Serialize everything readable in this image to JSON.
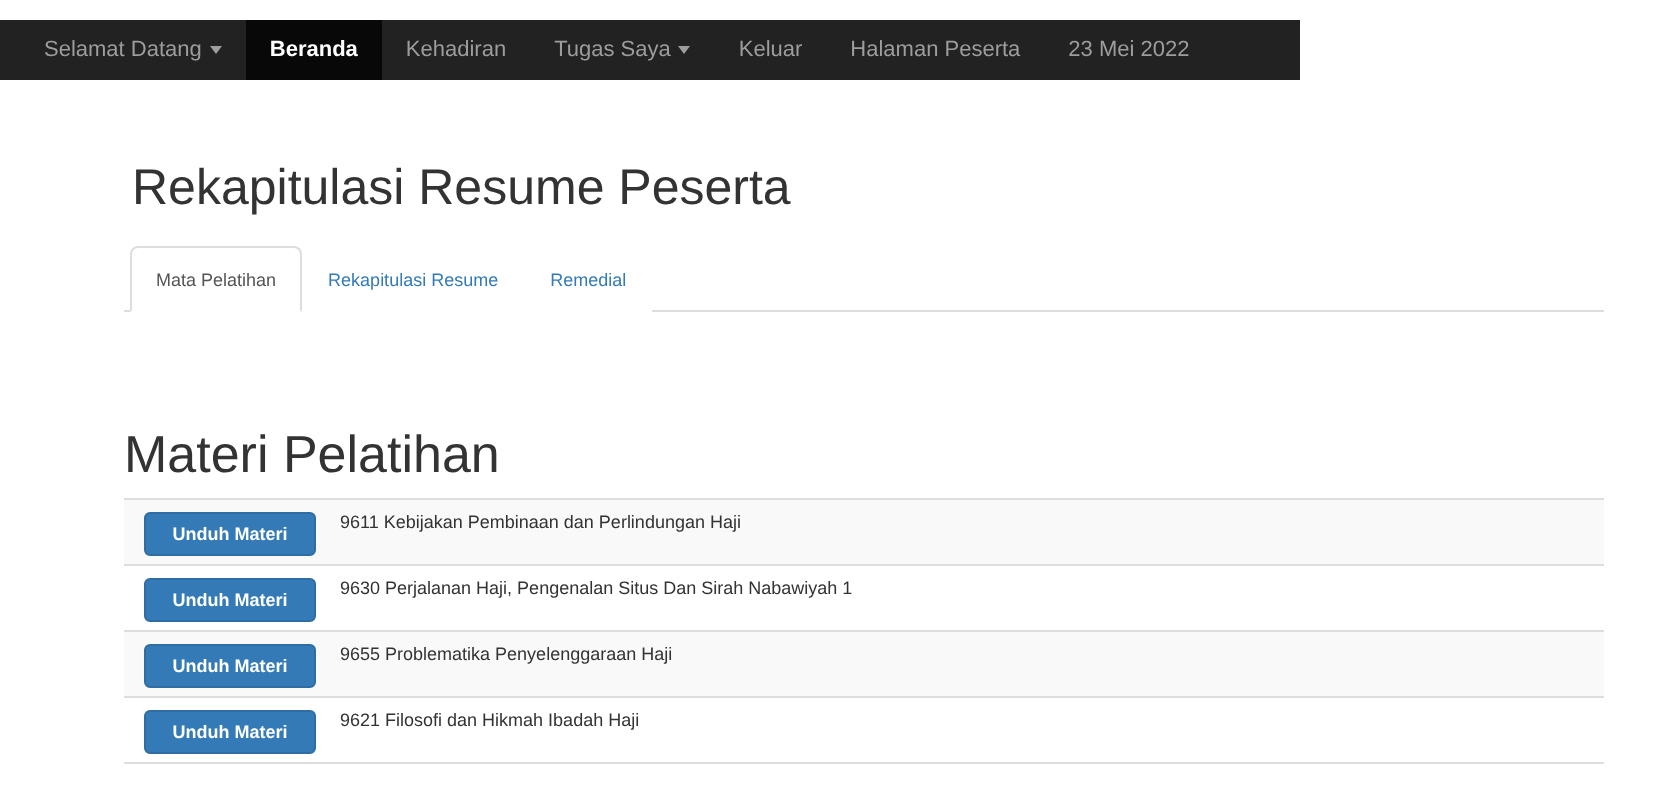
{
  "navbar": {
    "items": [
      {
        "label": "Selamat Datang",
        "dropdown": true,
        "selected": false
      },
      {
        "label": "Beranda",
        "dropdown": false,
        "selected": true
      },
      {
        "label": "Kehadiran",
        "dropdown": false,
        "selected": false
      },
      {
        "label": "Tugas Saya",
        "dropdown": true,
        "selected": false
      },
      {
        "label": "Keluar",
        "dropdown": false,
        "selected": false
      },
      {
        "label": "Halaman Peserta",
        "dropdown": false,
        "selected": false
      },
      {
        "label": "23 Mei 2022",
        "dropdown": false,
        "selected": false
      }
    ]
  },
  "page_title": "Rekapitulasi Resume Peserta",
  "tabs": [
    {
      "label": "Mata Pelatihan",
      "selected": true
    },
    {
      "label": "Rekapitulasi Resume",
      "selected": false
    },
    {
      "label": "Remedial",
      "selected": false
    }
  ],
  "section_title": "Materi Pelatihan",
  "materials": [
    {
      "button": "Unduh Materi",
      "title": "9611 Kebijakan Pembinaan dan Perlindungan Haji"
    },
    {
      "button": "Unduh Materi",
      "title": "9630 Perjalanan Haji, Pengenalan Situs Dan Sirah Nabawiyah 1"
    },
    {
      "button": "Unduh Materi",
      "title": "9655 Problematika Penyelenggaraan Haji"
    },
    {
      "button": "Unduh Materi",
      "title": "9621 Filosofi dan Hikmah Ibadah Haji"
    }
  ]
}
